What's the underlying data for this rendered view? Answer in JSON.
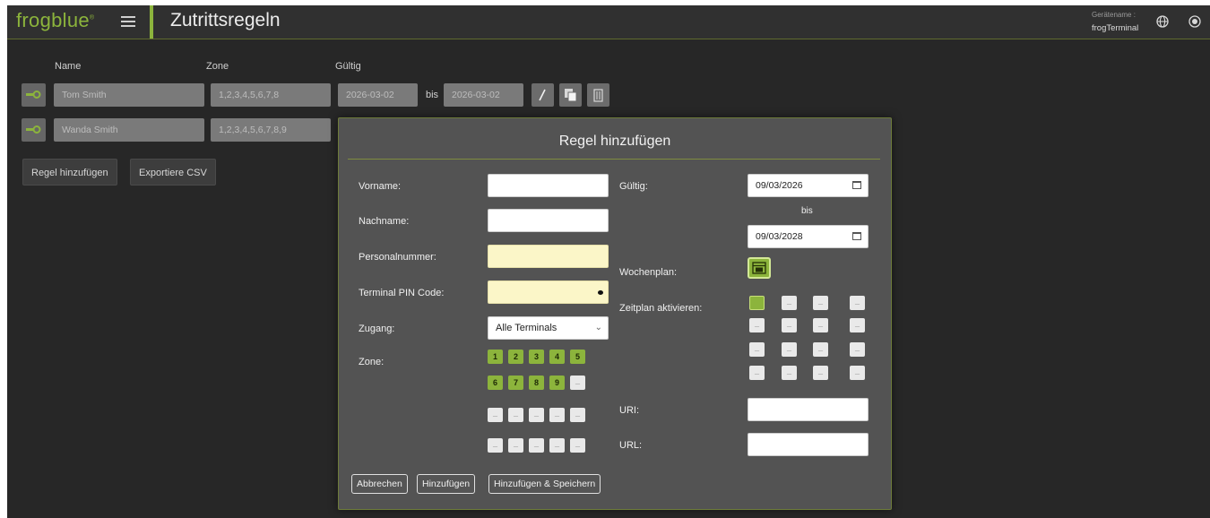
{
  "header": {
    "logo": "frogblue",
    "title": "Zutrittsregeln",
    "device_label": "Gerätename :",
    "device_name": "frogTerminal",
    "accent_color": "#8cb43c"
  },
  "table": {
    "columns": [
      "Name",
      "Zone",
      "Gültig"
    ],
    "bis": "bis",
    "rows": [
      {
        "name": "Tom Smith",
        "zone": "1,2,3,4,5,6,7,8",
        "from": "2026-03-02",
        "to": "2026-03-02"
      },
      {
        "name": "Wanda Smith",
        "zone": "1,2,3,4,5,6,7,8,9"
      }
    ]
  },
  "actions": {
    "add_rule": "Regel hinzufügen",
    "export_csv": "Exportiere CSV"
  },
  "modal": {
    "title": "Regel hinzufügen",
    "vorname_label": "Vorname:",
    "nachname_label": "Nachname:",
    "personalnummer_label": "Personalnummer:",
    "pin_label": "Terminal PIN Code:",
    "zugang_label": "Zugang:",
    "zugang_value": "Alle Terminals",
    "zone_label": "Zone:",
    "zones_on": [
      "1",
      "2",
      "3",
      "4",
      "5",
      "6",
      "7",
      "8",
      "9"
    ],
    "gueltig_label": "Gültig:",
    "date_from": "09/03/2026",
    "bis": "bis",
    "date_to": "09/03/2028",
    "wochenplan_label": "Wochenplan:",
    "zeitplan_label": "Zeitplan aktivieren:",
    "uri_label": "URI:",
    "url_label": "URL:",
    "cancel": "Abbrechen",
    "add": "Hinzufügen",
    "add_save": "Hinzufügen & Speichern"
  }
}
